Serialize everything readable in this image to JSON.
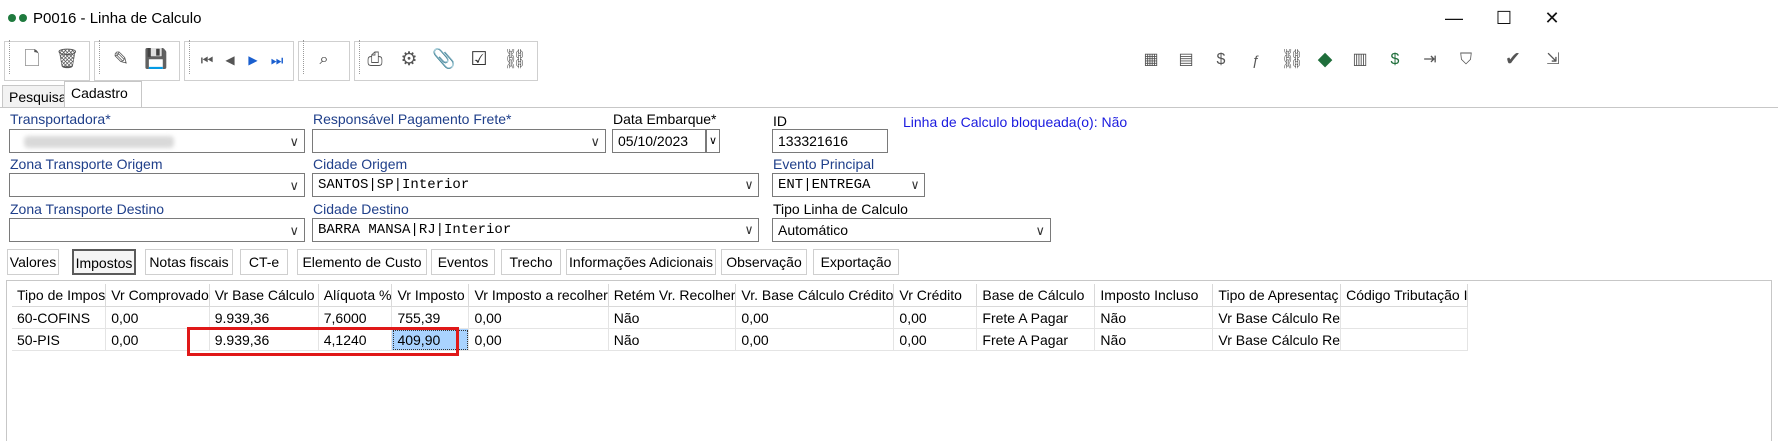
{
  "window": {
    "title": "P0016 - Linha de Calculo",
    "controls": [
      "minimize-icon",
      "maximize-icon",
      "close-icon"
    ]
  },
  "toolbar": {
    "left_icons": [
      "new-document-icon",
      "trash-icon",
      "edit-icon",
      "save-icon",
      "first-record-icon",
      "previous-record-icon",
      "next-record-icon",
      "last-record-icon",
      "search-records-icon",
      "print-icon",
      "settings-icon",
      "attachment-icon",
      "checkbox-icon",
      "link-icon"
    ],
    "right_icons": [
      "calculator-icon",
      "calendar-grid-icon",
      "money-sheet-icon",
      "formula-icon",
      "link-icon",
      "diamond-icon",
      "sheet-settings-icon",
      "money-refresh-icon",
      "table-export-icon",
      "shield-icon",
      "check-icon",
      "exit-icon"
    ]
  },
  "tabs": {
    "pesquisa": "Pesquisa",
    "cadastro": "Cadastro"
  },
  "form": {
    "transportadora": {
      "label": "Transportadora*",
      "value": ""
    },
    "responsavel": {
      "label": "Responsável Pagamento Frete*",
      "value": ""
    },
    "data_embarque": {
      "label": "Data Embarque*",
      "value": "05/10/2023"
    },
    "id": {
      "label": "ID",
      "value": "133321616"
    },
    "bloqueada": "Linha de Calculo bloqueada(o): Não",
    "zona_origem": {
      "label": "Zona Transporte Origem",
      "value": ""
    },
    "cidade_origem": {
      "label": "Cidade Origem",
      "value": "SANTOS|SP|Interior"
    },
    "evento_principal": {
      "label": "Evento Principal",
      "value": "ENT|ENTREGA"
    },
    "zona_destino": {
      "label": "Zona Transporte Destino",
      "value": ""
    },
    "cidade_destino": {
      "label": "Cidade Destino",
      "value": "BARRA MANSA|RJ|Interior"
    },
    "tipo_linha": {
      "label": "Tipo Linha de Calculo",
      "value": "Automático"
    }
  },
  "subtabs": [
    "Valores",
    "Impostos",
    "Notas fiscais",
    "CT-e",
    "Elemento de Custo",
    "Eventos",
    "Trecho",
    "Informações Adicionais",
    "Observação",
    "Exportação"
  ],
  "active_subtab": "Impostos",
  "table": {
    "headers": [
      "Tipo de Impos",
      "Vr Comprovado",
      "Vr Base Cálculo",
      "Alíquota %",
      "Vr Imposto",
      "Vr Imposto a recolher",
      "Retém Vr. Recolher",
      "Vr. Base Cálculo Crédito",
      "Vr Crédito",
      "Base de Cálculo",
      "Imposto Incluso",
      "Tipo de Apresentaç",
      "Código Tributação I"
    ],
    "rows": [
      [
        "60-COFINS",
        "0,00",
        "9.939,36",
        "7,6000",
        "755,39",
        "0,00",
        "Não",
        "0,00",
        "0,00",
        "Frete A Pagar",
        "Não",
        "Vr Base Cálculo Re",
        ""
      ],
      [
        "50-PIS",
        "0,00",
        "9.939,36",
        "4,1240",
        "409,90",
        "0,00",
        "Não",
        "0,00",
        "0,00",
        "Frete A Pagar",
        "Não",
        "Vr Base Cálculo Re",
        ""
      ]
    ]
  },
  "colors": {
    "label_blue": "#1f3f8a",
    "link_blue": "#1a1adf",
    "highlight": "#e01818",
    "selected_cell": "#a9d3ff"
  }
}
